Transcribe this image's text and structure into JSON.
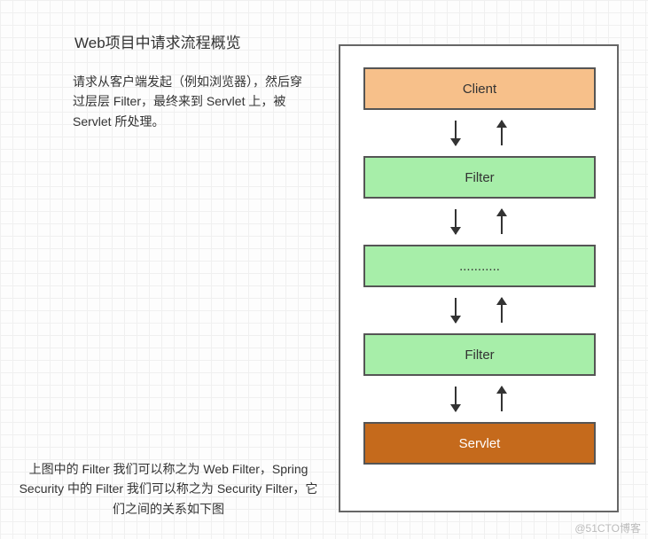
{
  "title": "Web项目中请求流程概览",
  "desc1": "请求从客户端发起（例如浏览器），然后穿过层层 Filter，最终来到 Servlet 上，被 Servlet 所处理。",
  "desc2": "上图中的 Filter 我们可以称之为 Web Filter，Spring Security 中的 Filter 我们可以称之为 Security Filter，它们之间的关系如下图",
  "boxes": {
    "client": "Client",
    "filter1": "Filter",
    "ellipsis": "...........",
    "filter2": "Filter",
    "servlet": "Servlet"
  },
  "colors": {
    "client_bg": "#f7c08a",
    "filter_bg": "#a7eea9",
    "servlet_bg": "#c56a1c",
    "grid": "#f0f0f0"
  },
  "watermark": "@51CTO博客",
  "chart_data": {
    "type": "flow-diagram",
    "nodes": [
      {
        "id": "client",
        "label": "Client",
        "color": "orange"
      },
      {
        "id": "filter1",
        "label": "Filter",
        "color": "green"
      },
      {
        "id": "dots",
        "label": "...........",
        "color": "green"
      },
      {
        "id": "filter2",
        "label": "Filter",
        "color": "green"
      },
      {
        "id": "servlet",
        "label": "Servlet",
        "color": "brown"
      }
    ],
    "edges": [
      {
        "from": "client",
        "to": "filter1",
        "bidirectional": true
      },
      {
        "from": "filter1",
        "to": "dots",
        "bidirectional": true
      },
      {
        "from": "dots",
        "to": "filter2",
        "bidirectional": true
      },
      {
        "from": "filter2",
        "to": "servlet",
        "bidirectional": true
      }
    ]
  }
}
